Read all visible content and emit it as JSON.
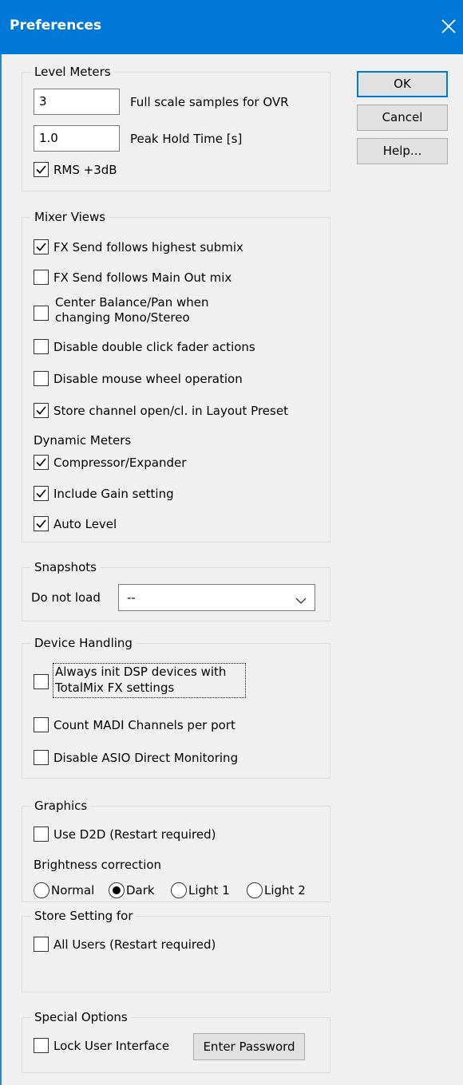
{
  "window": {
    "title": "Preferences",
    "close_icon": "close-icon",
    "accent_color": "#0078d7"
  },
  "buttons": {
    "ok": "OK",
    "cancel": "Cancel",
    "help": "Help..."
  },
  "level_meters": {
    "legend": "Level Meters",
    "full_scale_value": "3",
    "full_scale_label": "Full scale samples for OVR",
    "peak_hold_value": "1.0",
    "peak_hold_label": "Peak Hold Time [s]",
    "rms_label": "RMS +3dB",
    "rms_checked": true
  },
  "mixer_views": {
    "legend": "Mixer Views",
    "items": [
      {
        "label": "FX Send follows highest submix",
        "checked": true
      },
      {
        "label": "FX Send follows Main Out mix",
        "checked": false
      },
      {
        "label_line1": "Center Balance/Pan when",
        "label_line2": "changing Mono/Stereo",
        "checked": false
      },
      {
        "label": "Disable double click fader actions",
        "checked": false
      },
      {
        "label": "Disable mouse wheel operation",
        "checked": false
      },
      {
        "label": "Store channel open/cl. in Layout Preset",
        "checked": true
      }
    ],
    "dynamic_meters_label": "Dynamic Meters",
    "dynamic_items": [
      {
        "label": "Compressor/Expander",
        "checked": true
      },
      {
        "label": "Include Gain setting",
        "checked": true
      },
      {
        "label": "Auto Level",
        "checked": true
      }
    ]
  },
  "snapshots": {
    "legend": "Snapshots",
    "label": "Do not load",
    "selected": "--"
  },
  "device_handling": {
    "legend": "Device Handling",
    "items": [
      {
        "label_line1": "Always init DSP devices with",
        "label_line2": "TotalMix FX settings",
        "checked": false
      },
      {
        "label": "Count MADI Channels per port",
        "checked": false
      },
      {
        "label": "Disable ASIO Direct Monitoring",
        "checked": false
      }
    ]
  },
  "graphics": {
    "legend": "Graphics",
    "d2d_label": "Use D2D (Restart required)",
    "d2d_checked": false,
    "brightness_label": "Brightness correction",
    "options": [
      "Normal",
      "Dark",
      "Light 1",
      "Light 2"
    ],
    "selected": "Dark"
  },
  "store_setting": {
    "legend": "Store Setting for",
    "all_users_label": "All Users (Restart required)",
    "all_users_checked": false
  },
  "special_options": {
    "legend": "Special Options",
    "lock_label": "Lock User Interface",
    "lock_checked": false,
    "password_button": "Enter Password"
  }
}
